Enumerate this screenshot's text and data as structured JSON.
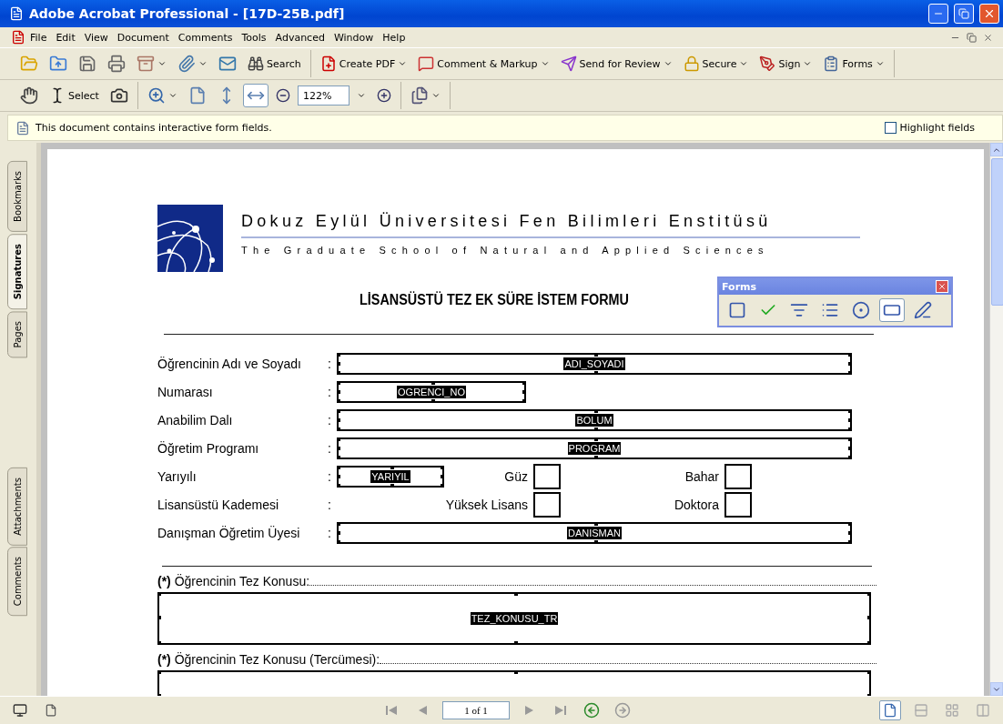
{
  "window": {
    "title": "Adobe Acrobat Professional - [17D-25B.pdf]"
  },
  "menu": [
    "File",
    "Edit",
    "View",
    "Document",
    "Comments",
    "Tools",
    "Advanced",
    "Window",
    "Help"
  ],
  "toolbar": {
    "search": {
      "label": "Search"
    },
    "tasks": [
      {
        "label": "Create PDF",
        "dropdown": true
      },
      {
        "label": "Comment & Markup",
        "dropdown": true
      },
      {
        "label": "Send for Review",
        "dropdown": true
      },
      {
        "label": "Secure",
        "dropdown": true
      },
      {
        "label": "Sign",
        "dropdown": true
      },
      {
        "label": "Forms",
        "dropdown": true
      }
    ]
  },
  "toolbar2": {
    "select": {
      "label": "Select"
    },
    "view_buttons": [
      {
        "selected": false
      },
      {
        "selected": false
      },
      {
        "selected": true
      }
    ],
    "zoom": {
      "value": "122%"
    }
  },
  "message_bar": {
    "text": "This document contains interactive form fields.",
    "highlight": {
      "label": "Highlight fields",
      "checked": false
    }
  },
  "nav_tabs": [
    {
      "label": "Bookmarks",
      "selected": false
    },
    {
      "label": "Signatures",
      "selected": true
    },
    {
      "label": "Pages",
      "selected": false
    },
    {
      "label": "Attachments",
      "selected": false
    },
    {
      "label": "Comments",
      "selected": false
    }
  ],
  "document": {
    "header": {
      "title": "Dokuz Eylül Üniversitesi Fen Bilimleri Enstitüsü",
      "subtitle": "The Graduate School of Natural and Applied Sciences"
    },
    "form_title": "LİSANSÜSTÜ TEZ EK SÜRE İSTEM FORMU",
    "rows": [
      {
        "kind": "field",
        "label": "Öğrencinin Adı ve Soyadı",
        "colon": ":",
        "field": "ADI_SOYADI"
      },
      {
        "kind": "short_field",
        "label": "Numarası",
        "colon": ":",
        "field": "OGRENCI_NO"
      },
      {
        "kind": "field",
        "label": "Anabilim Dalı",
        "colon": ":",
        "field": "BOLUM"
      },
      {
        "kind": "field",
        "label": "Öğretim Programı",
        "colon": ":",
        "field": "PROGRAM"
      },
      {
        "kind": "choice",
        "label": "Yarıyılı",
        "colon": ":",
        "field": "YARIYIL",
        "options": [
          {
            "label": "Güz",
            "checked": false
          },
          {
            "label": "Bahar",
            "checked": false
          }
        ]
      },
      {
        "kind": "choice",
        "label": "Lisansüstü Kademesi",
        "colon": ":",
        "options": [
          {
            "label": "Yüksek Lisans",
            "checked": false
          },
          {
            "label": "Doktora",
            "checked": false
          }
        ]
      },
      {
        "kind": "field",
        "label": "Danışman Öğretim Üyesi",
        "colon": ":",
        "field": "DANISMAN"
      }
    ],
    "sections": [
      {
        "label": "**(*)** Öğrencinin Tez Konusu:",
        "field": "TEZ_KONUSU_TR"
      },
      {
        "label": "**(*)** Öğrencinin Tez Konusu (Tercümesi):"
      }
    ]
  },
  "forms_palette": {
    "title": "Forms",
    "tools": [
      {
        "kind": "button",
        "selected": false
      },
      {
        "kind": "checkbox",
        "selected": false
      },
      {
        "kind": "combo",
        "selected": false
      },
      {
        "kind": "list",
        "selected": false
      },
      {
        "kind": "radio",
        "selected": false
      },
      {
        "kind": "text",
        "selected": true
      },
      {
        "kind": "signature",
        "selected": false
      }
    ]
  },
  "status_bar": {
    "page": "1 of 1",
    "layout_buttons": [
      {
        "selected": true
      },
      {
        "selected": false
      },
      {
        "selected": false
      },
      {
        "selected": false
      }
    ]
  }
}
